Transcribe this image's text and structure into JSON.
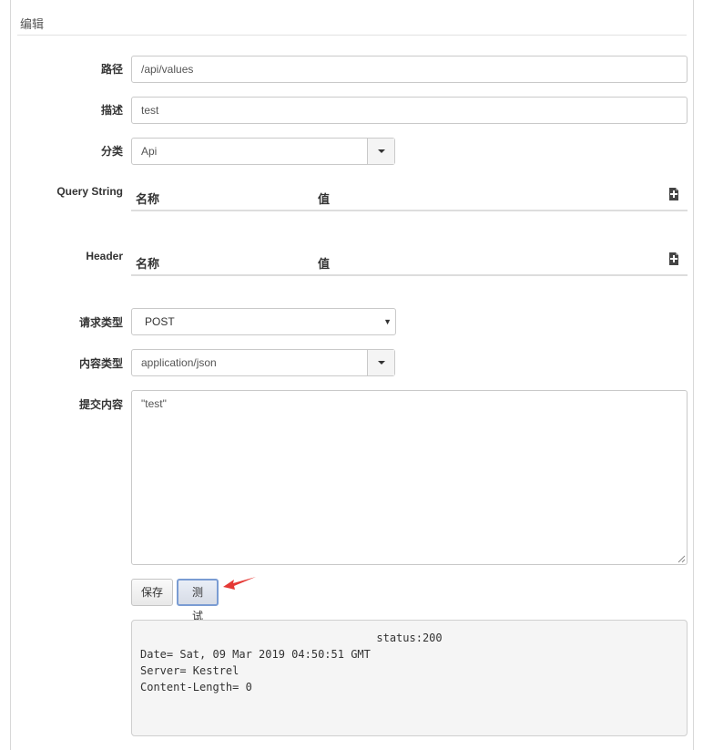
{
  "panel": {
    "title": "编辑"
  },
  "form": {
    "path": {
      "label": "路径",
      "value": "/api/values"
    },
    "description": {
      "label": "描述",
      "value": "test"
    },
    "category": {
      "label": "分类",
      "value": "Api"
    },
    "query_string": {
      "label": "Query String",
      "col_name": "名称",
      "col_value": "值",
      "add_icon": "add-row-icon"
    },
    "header": {
      "label": "Header",
      "col_name": "名称",
      "col_value": "值",
      "add_icon": "add-row-icon"
    },
    "request_type": {
      "label": "请求类型",
      "value": "POST"
    },
    "content_type": {
      "label": "内容类型",
      "value": "application/json"
    },
    "body": {
      "label": "提交内容",
      "value": "\"test\""
    }
  },
  "buttons": {
    "save": "保存",
    "test": "测试"
  },
  "result": {
    "status": "status:200",
    "lines": [
      "Date= Sat, 09 Mar 2019 04:50:51 GMT",
      "Server= Kestrel",
      "Content-Length= 0"
    ]
  },
  "colors": {
    "annotation_arrow": "#e53935",
    "active_button_border": "#7a9cd3"
  }
}
